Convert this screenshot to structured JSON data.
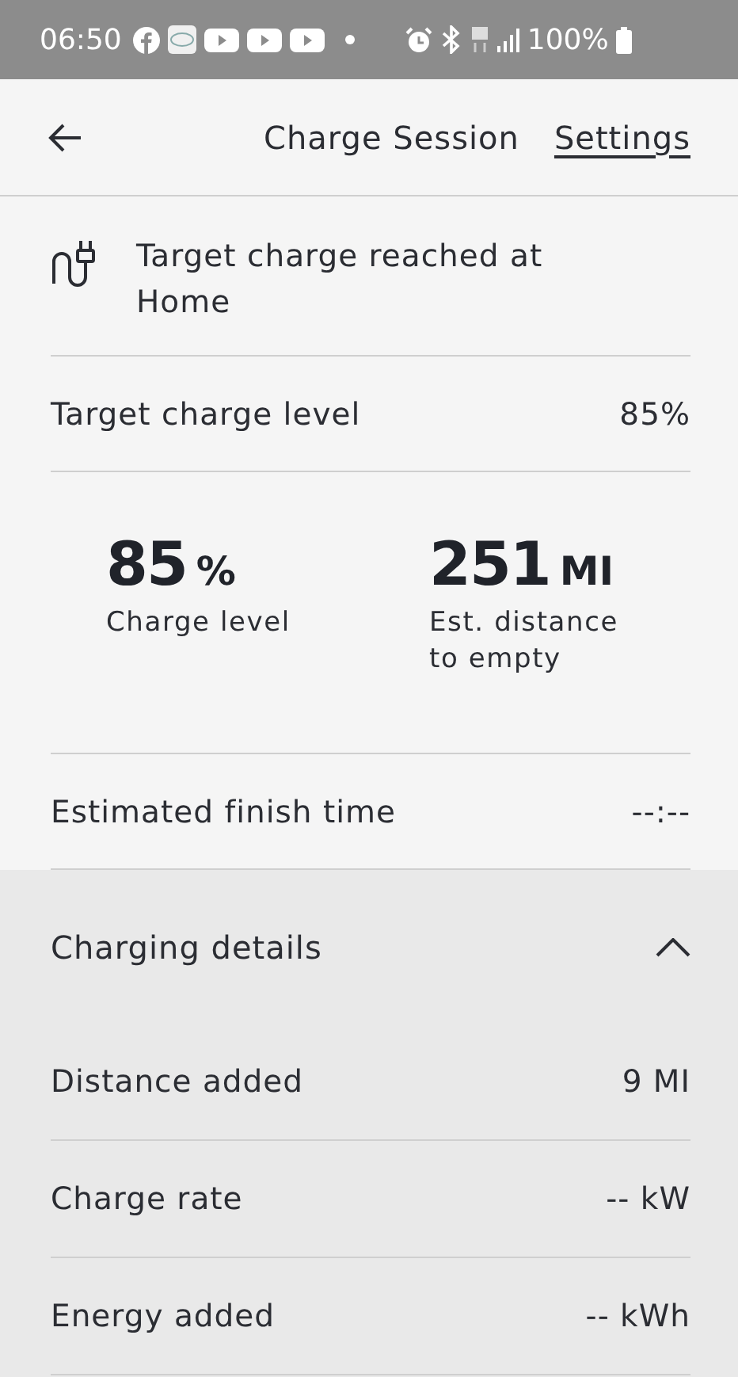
{
  "status_bar": {
    "time": "06:50",
    "battery": "100%"
  },
  "header": {
    "title": "Charge Session",
    "action": "Settings"
  },
  "notice": {
    "text": "Target charge reached at Home"
  },
  "target_row": {
    "label": "Target charge level",
    "value": "85%"
  },
  "stats": [
    {
      "value": "85",
      "unit": "%",
      "label": "Charge level"
    },
    {
      "value": "251",
      "unit": "MI",
      "label": "Est. distance to empty"
    }
  ],
  "finish_row": {
    "label": "Estimated finish time",
    "value": "--:--"
  },
  "charging_details": {
    "title": "Charging details",
    "expanded": true,
    "rows": [
      {
        "label": "Distance added",
        "value": "9 MI"
      },
      {
        "label": "Charge rate",
        "value": "-- kW"
      },
      {
        "label": "Energy added",
        "value": "-- kWh"
      }
    ]
  }
}
